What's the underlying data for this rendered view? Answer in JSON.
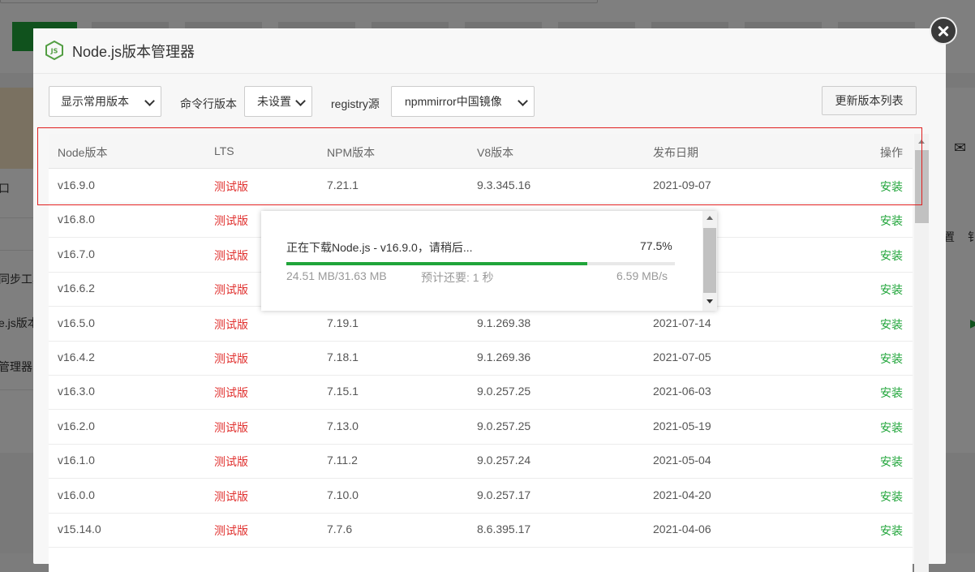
{
  "background": {
    "left_labels": [
      "口",
      "同步工具",
      "e.js版本",
      "管理器"
    ],
    "right_labels": [
      "置",
      "钅"
    ]
  },
  "dialog": {
    "title": "Node.js版本管理器",
    "logo_text": "JS"
  },
  "toolbar": {
    "version_filter": "显示常用版本",
    "cli_label": "命令行版本",
    "cli_value": "未设置",
    "registry_label": "registry源",
    "registry_value": "npmmirror中国镜像",
    "refresh_button": "更新版本列表"
  },
  "table": {
    "headers": [
      "Node版本",
      "LTS",
      "NPM版本",
      "V8版本",
      "发布日期",
      "操作"
    ],
    "rows": [
      [
        "v16.9.0",
        "测试版",
        "7.21.1",
        "9.3.345.16",
        "2021-09-07",
        "安装"
      ],
      [
        "v16.8.0",
        "测试版",
        "",
        "",
        "",
        "安装"
      ],
      [
        "v16.7.0",
        "测试版",
        "",
        "",
        "",
        "安装"
      ],
      [
        "v16.6.2",
        "测试版",
        "",
        "",
        "",
        "安装"
      ],
      [
        "v16.5.0",
        "测试版",
        "7.19.1",
        "9.1.269.38",
        "2021-07-14",
        "安装"
      ],
      [
        "v16.4.2",
        "测试版",
        "7.18.1",
        "9.1.269.36",
        "2021-07-05",
        "安装"
      ],
      [
        "v16.3.0",
        "测试版",
        "7.15.1",
        "9.0.257.25",
        "2021-06-03",
        "安装"
      ],
      [
        "v16.2.0",
        "测试版",
        "7.13.0",
        "9.0.257.25",
        "2021-05-19",
        "安装"
      ],
      [
        "v16.1.0",
        "测试版",
        "7.11.2",
        "9.0.257.24",
        "2021-05-04",
        "安装"
      ],
      [
        "v16.0.0",
        "测试版",
        "7.10.0",
        "9.0.257.17",
        "2021-04-20",
        "安装"
      ],
      [
        "v15.14.0",
        "测试版",
        "7.7.6",
        "8.6.395.17",
        "2021-04-06",
        "安装"
      ]
    ]
  },
  "download": {
    "title": "正在下载Node.js - v16.9.0，请稍后...",
    "percent_text": "77.5%",
    "progress": 0.775,
    "size": "24.51 MB/31.63 MB",
    "eta": "预计还要: 1 秒",
    "speed": "6.59 MB/s"
  },
  "colors": {
    "accent": "#20a53a",
    "lts": "#e0302e",
    "highlight": "#e02020"
  }
}
